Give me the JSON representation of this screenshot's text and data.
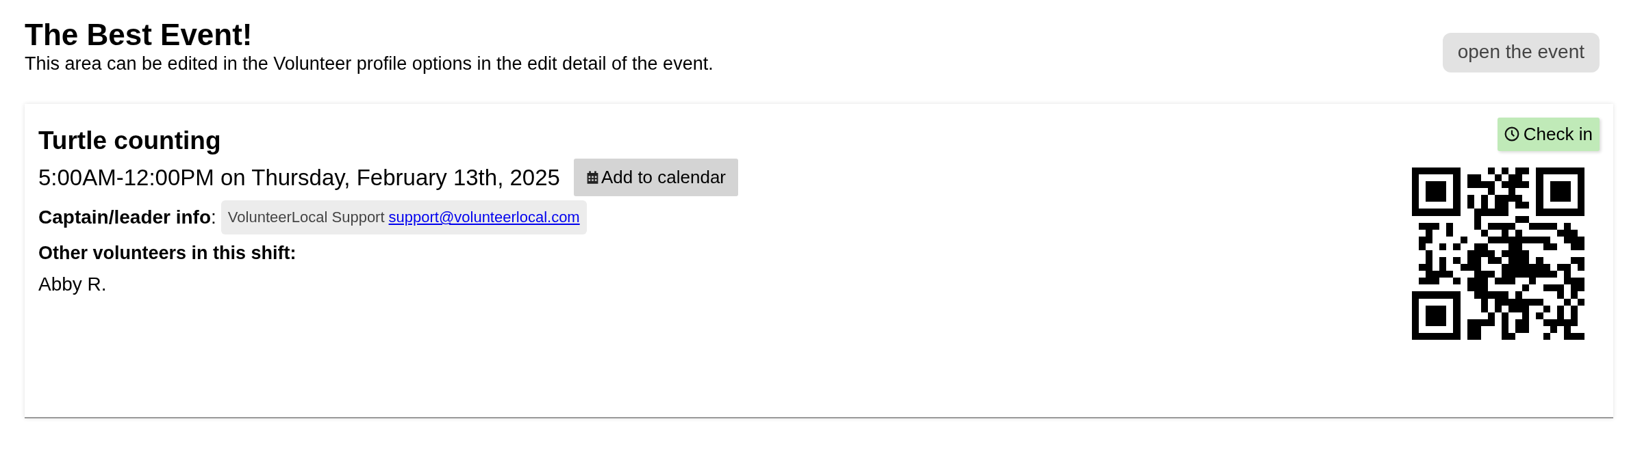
{
  "header": {
    "title": "The Best Event!",
    "description": "This area can be edited in the Volunteer profile options in the edit detail of the event.",
    "open_button": "open the event"
  },
  "shift": {
    "title": "Turtle counting",
    "time": "5:00AM-12:00PM on Thursday, February 13th, 2025",
    "calendar_button": "Add to calendar",
    "captain_label": "Captain/leader info",
    "captain_separator": ":",
    "captain_name": "VolunteerLocal Support",
    "captain_email": "support@volunteerlocal.com",
    "others_label": "Other volunteers in this shift:",
    "volunteers": [
      "Abby R."
    ],
    "check_in_button": "Check in"
  }
}
